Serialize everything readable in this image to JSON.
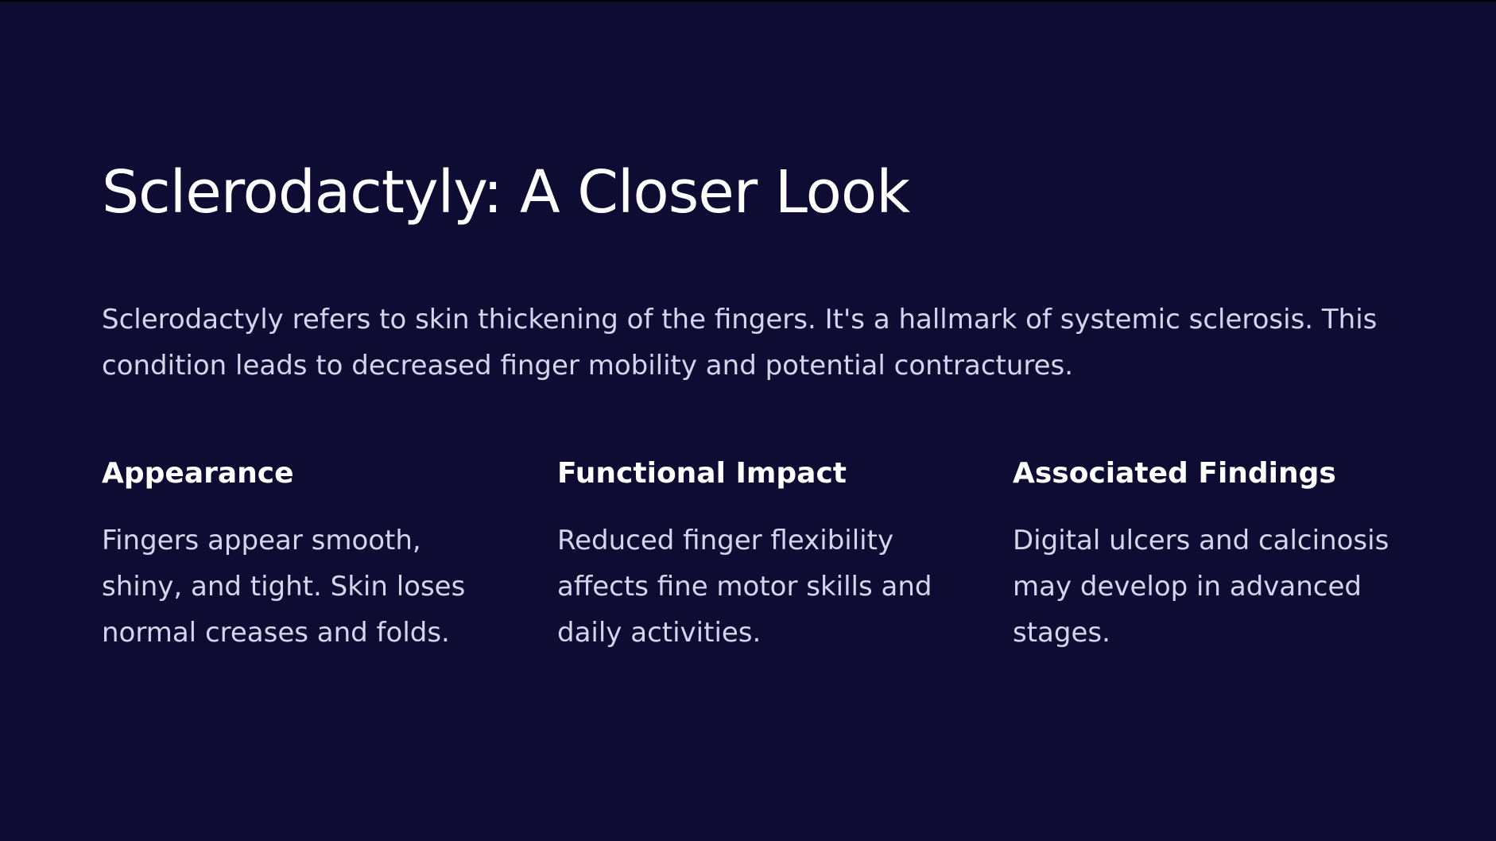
{
  "slide": {
    "title": "Sclerodactyly: A Closer Look",
    "intro": "Sclerodactyly refers to skin thickening of the fingers. It's a hallmark of systemic sclerosis. This condition leads to decreased finger mobility and potential contractures.",
    "columns": [
      {
        "heading": "Appearance",
        "body": "Fingers appear smooth, shiny, and tight. Skin loses normal creases and folds."
      },
      {
        "heading": "Functional Impact",
        "body": "Reduced finger flexibility affects fine motor skills and daily activities."
      },
      {
        "heading": "Associated Findings",
        "body": "Digital ulcers and calcinosis may develop in advanced stages."
      }
    ]
  },
  "colors": {
    "background": "#0f0c33",
    "heading_text": "#ffffff",
    "body_text": "#d6d4ea"
  }
}
